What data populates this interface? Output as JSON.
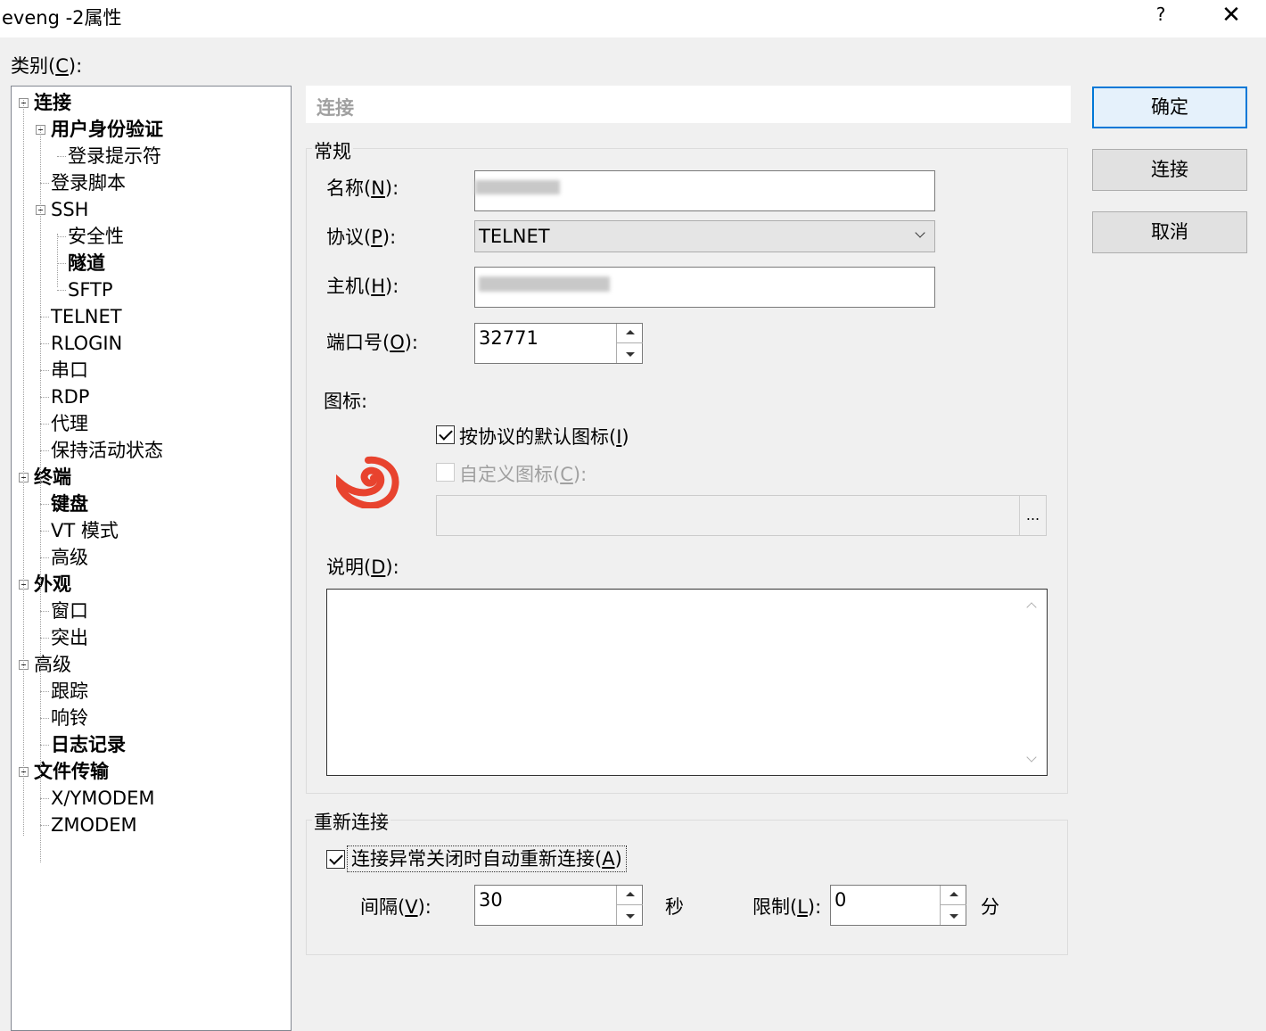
{
  "window": {
    "title": "eveng -2属性",
    "help": "?",
    "close": "✕"
  },
  "category_label": "类别(C):",
  "tree": [
    {
      "label": "连接",
      "bold": true,
      "level": 0,
      "expander": true
    },
    {
      "label": "用户身份验证",
      "bold": true,
      "level": 1,
      "expander": true
    },
    {
      "label": "登录提示符",
      "bold": false,
      "level": 2
    },
    {
      "label": "登录脚本",
      "bold": false,
      "level": 1
    },
    {
      "label": "SSH",
      "bold": false,
      "level": 1,
      "expander": true
    },
    {
      "label": "安全性",
      "bold": false,
      "level": 2
    },
    {
      "label": "隧道",
      "bold": true,
      "level": 2
    },
    {
      "label": "SFTP",
      "bold": false,
      "level": 2
    },
    {
      "label": "TELNET",
      "bold": false,
      "level": 1
    },
    {
      "label": "RLOGIN",
      "bold": false,
      "level": 1
    },
    {
      "label": "串口",
      "bold": false,
      "level": 1
    },
    {
      "label": "RDP",
      "bold": false,
      "level": 1
    },
    {
      "label": "代理",
      "bold": false,
      "level": 1
    },
    {
      "label": "保持活动状态",
      "bold": false,
      "level": 1
    },
    {
      "label": "终端",
      "bold": true,
      "level": 0,
      "expander": true
    },
    {
      "label": "键盘",
      "bold": true,
      "level": 1
    },
    {
      "label": "VT 模式",
      "bold": false,
      "level": 1
    },
    {
      "label": "高级",
      "bold": false,
      "level": 1
    },
    {
      "label": "外观",
      "bold": true,
      "level": 0,
      "expander": true
    },
    {
      "label": "窗口",
      "bold": false,
      "level": 1
    },
    {
      "label": "突出",
      "bold": false,
      "level": 1
    },
    {
      "label": "高级",
      "bold": false,
      "level": 0,
      "expander": true
    },
    {
      "label": "跟踪",
      "bold": false,
      "level": 1
    },
    {
      "label": "响铃",
      "bold": false,
      "level": 1
    },
    {
      "label": "日志记录",
      "bold": true,
      "level": 1
    },
    {
      "label": "文件传输",
      "bold": true,
      "level": 0,
      "expander": true
    },
    {
      "label": "X/YMODEM",
      "bold": false,
      "level": 1
    },
    {
      "label": "ZMODEM",
      "bold": false,
      "level": 1
    }
  ],
  "section_header": "连接",
  "general": {
    "title": "常规",
    "name_label_pre": "名称(",
    "name_key": "N",
    "name_label_post": "):",
    "name_value": "",
    "protocol_label_pre": "协议(",
    "protocol_key": "P",
    "protocol_label_post": "):",
    "protocol_value": "TELNET",
    "host_label_pre": "主机(",
    "host_key": "H",
    "host_label_post": "):",
    "host_value": "",
    "port_label_pre": "端口号(",
    "port_key": "O",
    "port_label_post": "):",
    "port_value": "32771",
    "icon_label": "图标:",
    "default_icon_pre": "按协议的默认图标(",
    "default_icon_key": "I",
    "default_icon_post": ")",
    "default_icon_checked": true,
    "custom_icon_pre": "自定义图标(",
    "custom_icon_key": "C",
    "custom_icon_post": "):",
    "custom_icon_checked": false,
    "browse_label": "...",
    "desc_label_pre": "说明(",
    "desc_key": "D",
    "desc_label_post": "):",
    "desc_value": ""
  },
  "reconnect": {
    "title": "重新连接",
    "auto_pre": "连接异常关闭时自动重新连接(",
    "auto_key": "A",
    "auto_post": ")",
    "auto_checked": true,
    "interval_label_pre": "间隔(",
    "interval_key": "V",
    "interval_label_post": "):",
    "interval_value": "30",
    "interval_unit": "秒",
    "limit_label_pre": "限制(",
    "limit_key": "L",
    "limit_label_post": "):",
    "limit_value": "0",
    "limit_unit": "分"
  },
  "buttons": {
    "ok": "确定",
    "connect": "连接",
    "cancel": "取消"
  },
  "colors": {
    "accent": "#0078d7",
    "icon": "#e8432e"
  },
  "icons": {
    "protocol_icon": "telnet-shell-icon"
  }
}
